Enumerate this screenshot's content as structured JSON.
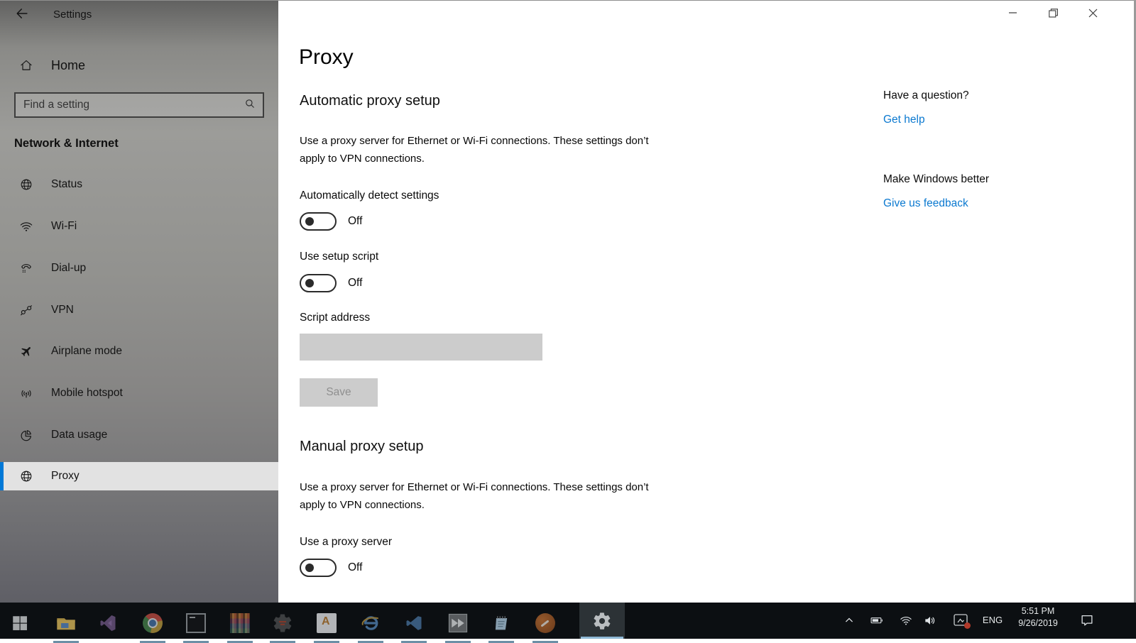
{
  "window": {
    "title": "Settings",
    "controls": {
      "minimize": "minimize",
      "restore": "restore-down",
      "close": "close"
    }
  },
  "sidebar": {
    "title": "Settings",
    "home": {
      "label": "Home",
      "icon": "home-icon"
    },
    "search": {
      "placeholder": "Find a setting",
      "icon": "search-icon"
    },
    "section_heading": "Network & Internet",
    "items": [
      {
        "label": "Status",
        "icon": "globe-icon",
        "selected": false
      },
      {
        "label": "Wi-Fi",
        "icon": "wifi-icon",
        "selected": false
      },
      {
        "label": "Dial-up",
        "icon": "phone-icon",
        "selected": false
      },
      {
        "label": "VPN",
        "icon": "vpn-icon",
        "selected": false
      },
      {
        "label": "Airplane mode",
        "icon": "airplane-icon",
        "selected": false
      },
      {
        "label": "Mobile hotspot",
        "icon": "hotspot-icon",
        "selected": false
      },
      {
        "label": "Data usage",
        "icon": "pie-chart-icon",
        "selected": false
      },
      {
        "label": "Proxy",
        "icon": "globe-icon",
        "selected": true
      }
    ]
  },
  "main": {
    "page_title": "Proxy",
    "auto": {
      "heading": "Automatic proxy setup",
      "description": "Use a proxy server for Ethernet or Wi-Fi connections. These settings don’t apply to VPN connections.",
      "detect_label": "Automatically detect settings",
      "detect_state": "Off",
      "script_toggle_label": "Use setup script",
      "script_toggle_state": "Off",
      "script_address_label": "Script address",
      "script_address_value": "",
      "save_label": "Save"
    },
    "manual": {
      "heading": "Manual proxy setup",
      "description": "Use a proxy server for Ethernet or Wi-Fi connections. These settings don’t apply to VPN connections.",
      "proxy_label": "Use a proxy server",
      "proxy_state": "Off"
    },
    "help": {
      "question_heading": "Have a question?",
      "get_help_link": "Get help",
      "better_heading": "Make Windows better",
      "feedback_link": "Give us feedback"
    }
  },
  "taskbar": {
    "icons": [
      "start",
      "file-explorer",
      "visual-studio",
      "chrome",
      "command-prompt",
      "archive-manager",
      "java-ide-gear",
      "text-editor",
      "internet-explorer",
      "vs-code",
      "media-forward",
      "notepad",
      "screwdriver-tool",
      "settings-gear"
    ],
    "active_icon": "settings-gear",
    "tray": {
      "hidden_icons": "chevron-up",
      "language": "ENG",
      "time": "5:51 PM",
      "date": "9/26/2019"
    }
  },
  "colors": {
    "accent_blue": "#0078d7",
    "link_blue": "#0b79d0",
    "disabled_gray": "#cccccc",
    "taskbar_bg": "#0c0f12"
  }
}
